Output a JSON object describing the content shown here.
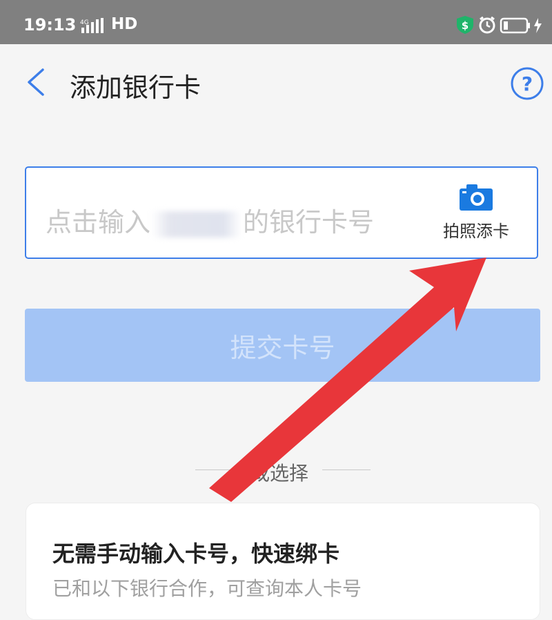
{
  "status_bar": {
    "time": "19:13",
    "network": "4G",
    "hd": "HD",
    "icons": [
      "shield-dollar-icon",
      "alarm-icon",
      "battery-icon",
      "charging-icon"
    ]
  },
  "header": {
    "back_icon": "chevron-left-icon",
    "title": "添加银行卡",
    "help_icon": "question-circle-icon",
    "help_glyph": "?"
  },
  "card_input": {
    "placeholder_before": "点击输入",
    "placeholder_after": "的银行卡号",
    "photo_icon": "camera-icon",
    "photo_label": "拍照添卡"
  },
  "submit": {
    "label": "提交卡号"
  },
  "divider": {
    "text": "或选择"
  },
  "quick_bind": {
    "title": "无需手动输入卡号，快速绑卡",
    "subtitle": "已和以下银行合作，可查询本人卡号"
  },
  "colors": {
    "accent": "#3d7ee9",
    "submit_bg": "#a3c4f5",
    "arrow": "#e8363a",
    "status_bar": "#808080"
  }
}
